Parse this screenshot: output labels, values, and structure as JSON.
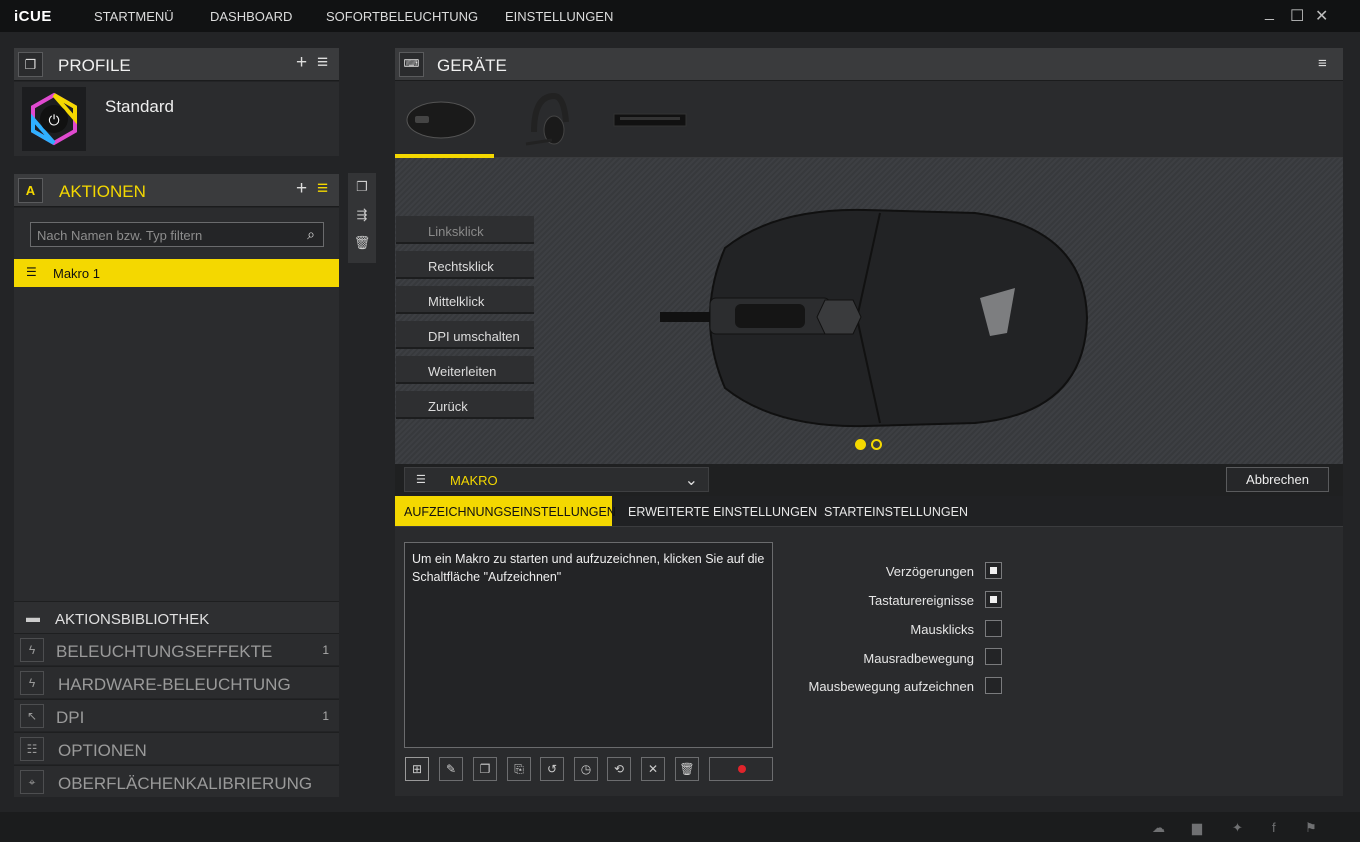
{
  "app": {
    "title": "iCUE"
  },
  "nav": [
    "STARTMENÜ",
    "DASHBOARD",
    "SOFORTBELEUCHTUNG",
    "EINSTELLUNGEN"
  ],
  "profile": {
    "header": "PROFILE",
    "name": "Standard"
  },
  "actions": {
    "header": "AKTIONEN",
    "search_placeholder": "Nach Namen bzw. Typ filtern",
    "items": [
      "Makro 1"
    ]
  },
  "library": [
    {
      "label": "AKTIONSBIBLIOTHEK",
      "count": ""
    },
    {
      "label": "BELEUCHTUNGSEFFEKTE",
      "count": "1"
    },
    {
      "label": "HARDWARE-BELEUCHTUNG",
      "count": ""
    },
    {
      "label": "DPI",
      "count": "1"
    },
    {
      "label": "OPTIONEN",
      "count": ""
    },
    {
      "label": "OBERFLÄCHENKALIBRIERUNG",
      "count": ""
    }
  ],
  "devices": {
    "header": "GERÄTE"
  },
  "mouse_buttons": [
    "Linksklick",
    "Rechtsklick",
    "Mittelklick",
    "DPI umschalten",
    "Weiterleiten",
    "Zurück"
  ],
  "macro": {
    "type": "MAKRO",
    "cancel": "Abbrechen",
    "tabs": [
      "AUFZEICHNUNGSEINSTELLUNGEN",
      "ERWEITERTE EINSTELLUNGEN",
      "STARTEINSTELLUNGEN"
    ],
    "hint": "Um ein Makro zu starten und aufzuzeichnen, klicken Sie auf die Schaltfläche \"Aufzeichnen\"",
    "options": [
      {
        "label": "Verzögerungen",
        "checked": true
      },
      {
        "label": "Tastaturereignisse",
        "checked": true
      },
      {
        "label": "Mausklicks",
        "checked": false
      },
      {
        "label": "Mausradbewegung",
        "checked": false
      },
      {
        "label": "Mausbewegung aufzeichnen",
        "checked": false
      }
    ]
  },
  "colors": {
    "accent": "#f4d800",
    "record": "#e0242b"
  }
}
